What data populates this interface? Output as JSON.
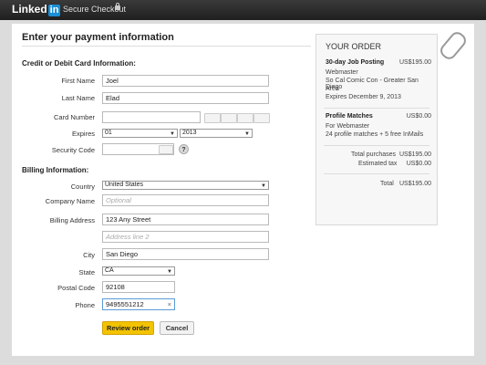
{
  "header": {
    "logo_text": "Linked",
    "logo_in": "in",
    "secure_label": "Secure Checkout"
  },
  "main": {
    "title": "Enter your payment information",
    "card_section": "Credit or Debit Card Information:",
    "billing_section": "Billing Information:"
  },
  "form": {
    "first_name": {
      "label": "First Name",
      "value": "Joel"
    },
    "last_name": {
      "label": "Last Name",
      "value": "Elad"
    },
    "card_number": {
      "label": "Card Number",
      "value": ""
    },
    "expires": {
      "label": "Expires",
      "month": "01",
      "year": "2013"
    },
    "security_code": {
      "label": "Security Code",
      "value": "",
      "help": "?"
    },
    "country": {
      "label": "Country",
      "value": "United States"
    },
    "company": {
      "label": "Company Name",
      "placeholder": "Optional"
    },
    "address": {
      "label": "Billing Address",
      "value": "123 Any Street",
      "line2_placeholder": "Address line 2"
    },
    "city": {
      "label": "City",
      "value": "San Diego"
    },
    "state": {
      "label": "State",
      "value": "CA"
    },
    "postal": {
      "label": "Postal Code",
      "value": "92108"
    },
    "phone": {
      "label": "Phone",
      "value": "9495551212",
      "clear": "×"
    },
    "card_icons": [
      "visa-icon",
      "mastercard-icon",
      "amex-icon",
      "discover-icon"
    ]
  },
  "buttons": {
    "review": "Review order",
    "cancel": "Cancel"
  },
  "order": {
    "title": "YOUR ORDER",
    "item1": {
      "name": "30-day Job Posting",
      "price": "US$195.00",
      "l1": "Webmaster",
      "l2": "So Cal Comic Con - Greater San Diego",
      "l3": "Area",
      "l4": "Expires December 9, 2013"
    },
    "item2": {
      "name": "Profile Matches",
      "price": "US$0.00",
      "l1": "For Webmaster",
      "l2": "24 profile matches + 5 free InMails"
    },
    "total_purchases_label": "Total purchases",
    "total_purchases": "US$195.00",
    "tax_label": "Estimated tax",
    "tax": "US$0.00",
    "total_label": "Total",
    "total": "US$195.00"
  },
  "colors": {
    "accent": "#f3c300",
    "header": "#2a2a2a",
    "logo_blue": "#1a8fd6"
  }
}
